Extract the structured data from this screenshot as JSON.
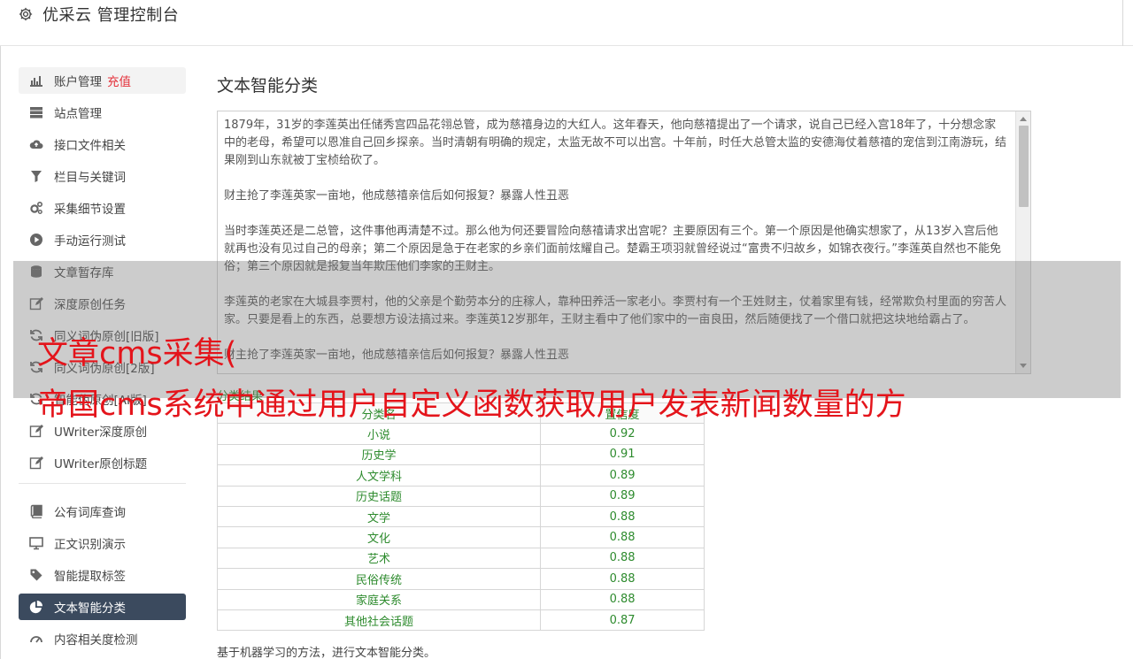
{
  "header": {
    "title": "优采云 管理控制台",
    "icon": "gear-icon"
  },
  "sidebar": {
    "items": [
      {
        "label": "账户管理",
        "extra": "充值",
        "icon": "bar-chart-icon"
      },
      {
        "label": "站点管理",
        "icon": "server-icon"
      },
      {
        "label": "接口文件相关",
        "icon": "cloud-upload-icon"
      },
      {
        "label": "栏目与关键词",
        "icon": "filter-icon"
      },
      {
        "label": "采集细节设置",
        "icon": "cogs-icon"
      },
      {
        "label": "手动运行测试",
        "icon": "play-circle-icon"
      },
      {
        "label": "文章暂存库",
        "icon": "database-icon"
      },
      {
        "label": "深度原创任务",
        "icon": "edit-icon"
      },
      {
        "label": "同义词伪原创[旧版]",
        "icon": "refresh-icon"
      },
      {
        "label": "同义词伪原创[2版]",
        "icon": "refresh-icon"
      },
      {
        "label": "智能伪原创[AI版]",
        "icon": "refresh-icon"
      },
      {
        "label": "UWriter深度原创",
        "icon": "edit-icon"
      },
      {
        "label": "UWriter原创标题",
        "icon": "edit-icon"
      }
    ],
    "items2": [
      {
        "label": "公有词库查询",
        "icon": "book-icon"
      },
      {
        "label": "正文识别演示",
        "icon": "monitor-icon"
      },
      {
        "label": "智能提取标签",
        "icon": "tag-icon"
      },
      {
        "label": "文本智能分类",
        "icon": "pie-chart-icon"
      },
      {
        "label": "内容相关度检测",
        "icon": "gauge-icon"
      }
    ],
    "active_index": 3
  },
  "main": {
    "title": "文本智能分类",
    "text_paragraphs": [
      "1879年，31岁的李莲英出任储秀宫四品花翎总管，成为慈禧身边的大红人。这年春天，他向慈禧提出了一个请求，说自己已经入宫18年了，十分想念家中的老母，希望可以恩准自己回乡探亲。当时清朝有明确的规定，太监无故不可以出宫。十年前，时任大总管太监的安德海仗着慈禧的宠信到江南游玩，结果刚到山东就被丁宝桢给砍了。",
      "财主抢了李莲英家一亩地，他成慈禧亲信后如何报复？暴露人性丑恶",
      "当时李莲英还是二总管，这件事他再清楚不过。那么他为何还要冒险向慈禧请求出宫呢？主要原因有三个。第一个原因是他确实想家了，从13岁入宫后他就再也没有见过自己的母亲；第二个原因是急于在老家的乡亲们面前炫耀自己。楚霸王项羽就曾经说过“富贵不归故乡，如锦衣夜行。”李莲英自然也不能免俗；第三个原因就是报复当年欺压他们李家的王财主。",
      "李莲英的老家在大城县李贾村，他的父亲是个勤劳本分的庄稼人，靠种田养活一家老小。李贾村有一个王姓财主，仗着家里有钱，经常欺负村里面的穷苦人家。只要是看上的东西，总要想方设法搞过来。李莲英12岁那年，王财主看中了他们家中的一亩良田，然后随便找了一个借口就把这块地给霸占了。",
      "财主抢了李莲英家一亩地，他成慈禧亲信后如何报复？暴露人性丑恶"
    ],
    "result_label": "分类结果",
    "table_headers": [
      "分类名",
      "置信度"
    ],
    "table_rows": [
      [
        "小说",
        "0.92"
      ],
      [
        "历史学",
        "0.91"
      ],
      [
        "人文学科",
        "0.89"
      ],
      [
        "历史话题",
        "0.89"
      ],
      [
        "文学",
        "0.88"
      ],
      [
        "文化",
        "0.88"
      ],
      [
        "艺术",
        "0.88"
      ],
      [
        "民俗传统",
        "0.88"
      ],
      [
        "家庭关系",
        "0.88"
      ],
      [
        "其他社会话题",
        "0.87"
      ]
    ],
    "footnote": "基于机器学习的方法，进行文本智能分类。"
  },
  "overlay": {
    "line1": "文章cms采集(",
    "line2": "帝国cms系统中通过用户自定义函数获取用户发表新闻数量的方"
  },
  "colors": {
    "accent_red": "#e4313b",
    "active_bg": "#3b4a5e",
    "result_green": "#2e8b2e",
    "overlay_red": "#e4141b"
  }
}
